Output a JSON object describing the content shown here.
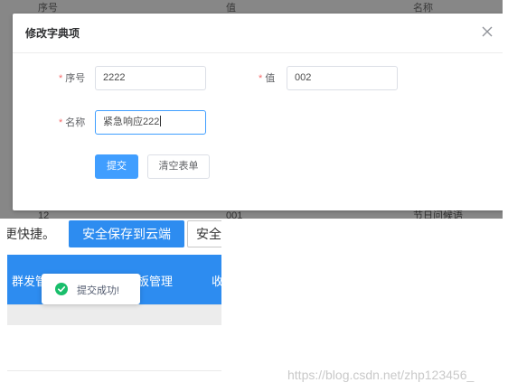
{
  "background_table": {
    "row_top": [
      "序号",
      "值",
      "名称"
    ],
    "row_bottom": [
      "12",
      "001",
      "节日问候语"
    ]
  },
  "dialog": {
    "title": "修改字典项",
    "close_icon": "close-icon",
    "fields": {
      "order": {
        "label": "序号",
        "value": "2222",
        "required": true
      },
      "value": {
        "label": "值",
        "value": "002",
        "required": true
      },
      "name": {
        "label": "名称",
        "value": "紧急响应222",
        "required": true
      }
    },
    "submit_label": "提交",
    "clear_label": "清空表单",
    "accent_color": "#409eff",
    "required_color": "#f56c6c"
  },
  "lower_app": {
    "text_left": "更快捷。",
    "cloud_button": "安全保存到云端",
    "safe_button": "安全",
    "nav_items": [
      "群发管",
      "板管理",
      "收"
    ],
    "nav_color": "#2d8cf0"
  },
  "toast": {
    "icon": "check-circle-icon",
    "message": "提交成功!",
    "color": "#19be6b"
  },
  "watermark": "https://blog.csdn.net/zhp123456_"
}
